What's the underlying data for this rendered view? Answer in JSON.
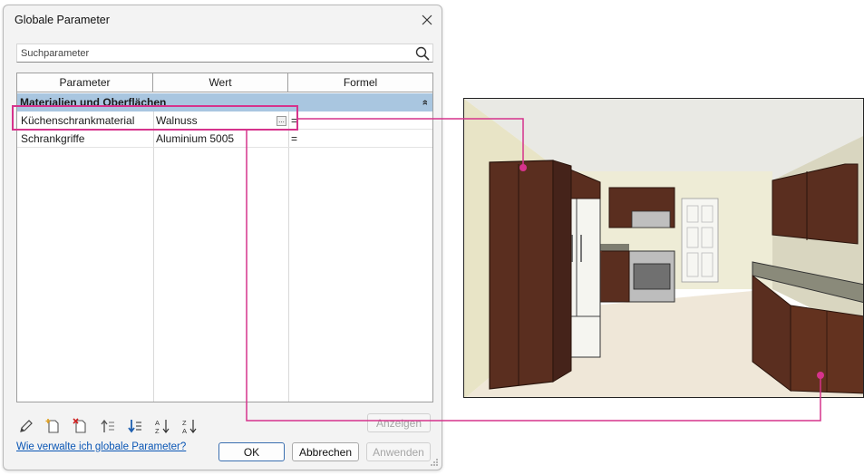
{
  "dialog": {
    "title": "Globale Parameter",
    "search": {
      "placeholder": "Suchparameter"
    },
    "columns": [
      "Parameter",
      "Wert",
      "Formel"
    ],
    "group": {
      "label": "Materialien und Oberflächen",
      "chevron": "»"
    },
    "rows": [
      {
        "parameter": "Küchenschrankmaterial",
        "value": "Walnuss",
        "value_button": "...",
        "formula": "="
      },
      {
        "parameter": "Schrankgriffe",
        "value": "Aluminium 5005",
        "formula": "="
      }
    ],
    "toolbar": {
      "icons": [
        "edit-icon",
        "new-parameter-icon",
        "delete-parameter-icon",
        "move-up-icon",
        "move-down-icon",
        "sort-ascending-icon",
        "sort-descending-icon"
      ],
      "sort_ascending_label": "AZ",
      "sort_descending_label": "ZA"
    },
    "show_button": "Anzeigen",
    "help_link": "Wie verwalte ich globale Parameter?",
    "ok_button": "OK",
    "cancel_button": "Abbrechen",
    "apply_button": "Anwenden"
  },
  "colors": {
    "highlight": "#d6338c",
    "group_row": "#a9c6e0",
    "link": "#0a56b5",
    "cabinet_walnut": "#5a2e1f",
    "countertop": "#8a8a7a"
  },
  "render": {
    "subject": "kitchen-3d-view"
  }
}
